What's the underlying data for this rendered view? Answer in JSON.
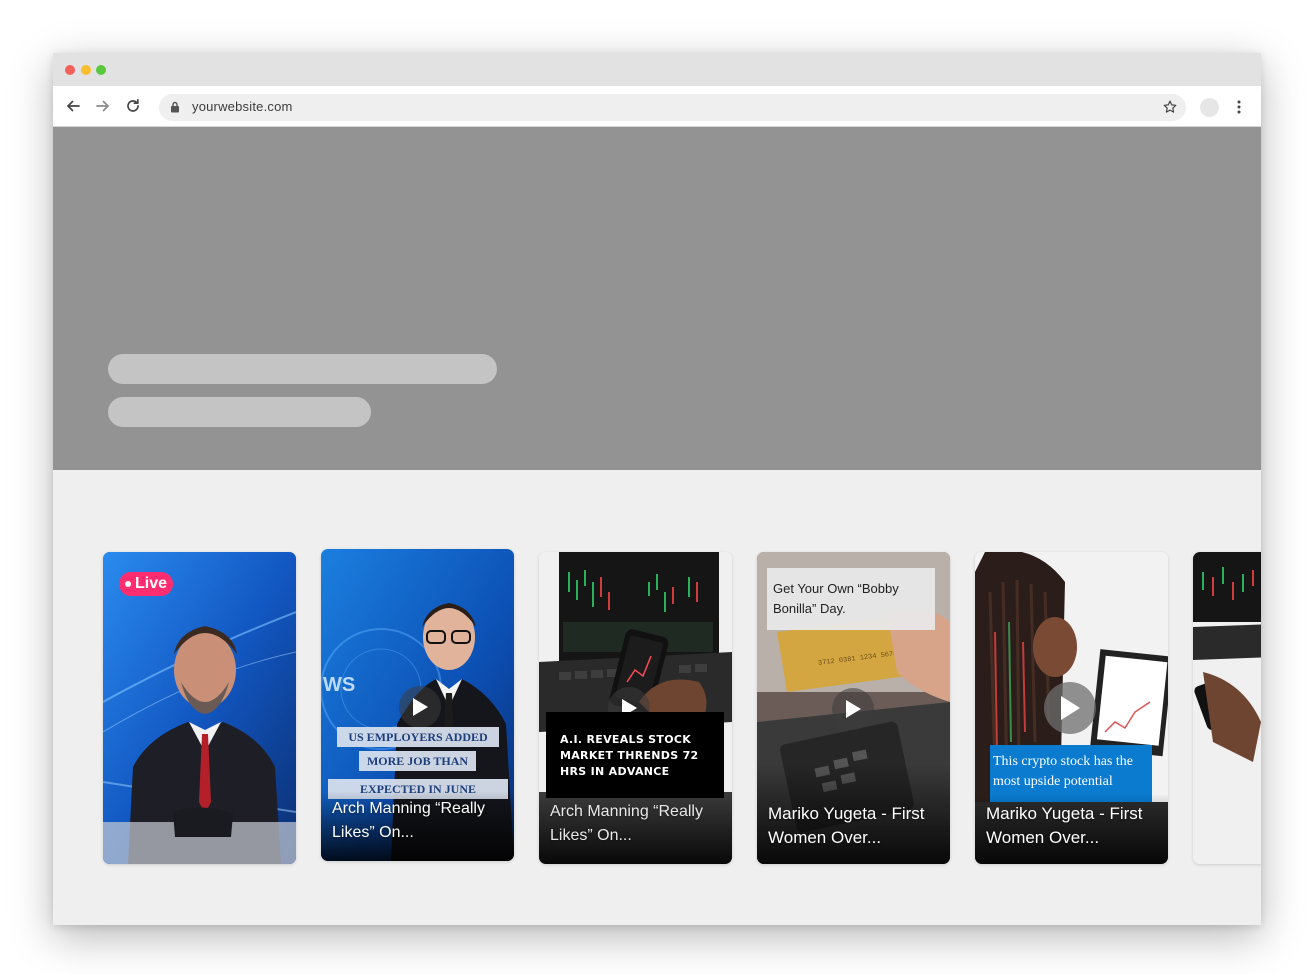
{
  "browser": {
    "url": "yourwebsite.com",
    "traffic_lights": {
      "close": "#f25f58",
      "minimize": "#fbbe2e",
      "maximize": "#58c93f"
    }
  },
  "hero": {
    "background": "#939393",
    "skeleton_color": "#c4c4c4"
  },
  "cards": [
    {
      "badge": "Live",
      "title": ""
    },
    {
      "overlay_lines": [
        "US EMPLOYERS ADDED",
        "MORE JOB THAN",
        "EXPECTED IN JUNE"
      ],
      "title": "Arch Manning “Really Likes” On..."
    },
    {
      "overlay_lines": [
        "A.I. REVEALS STOCK",
        "MARKET THRENDS 72",
        "HRS IN ADVANCE"
      ],
      "title": "Arch Manning “Really Likes” On..."
    },
    {
      "overlay_text": "Get Your Own “Bobby Bonilla” Day.",
      "title": "Mariko Yugeta - First Women Over..."
    },
    {
      "overlay_text": "This crypto stock has the most upside potential",
      "title": "Mariko Yugeta - First Women Over..."
    },
    {
      "title": ""
    }
  ],
  "icons": {
    "back": "arrow-left-icon",
    "forward": "arrow-right-icon",
    "reload": "reload-icon",
    "lock": "lock-icon",
    "bookmark": "star-icon",
    "menu": "kebab-menu-icon",
    "play": "play-icon"
  }
}
